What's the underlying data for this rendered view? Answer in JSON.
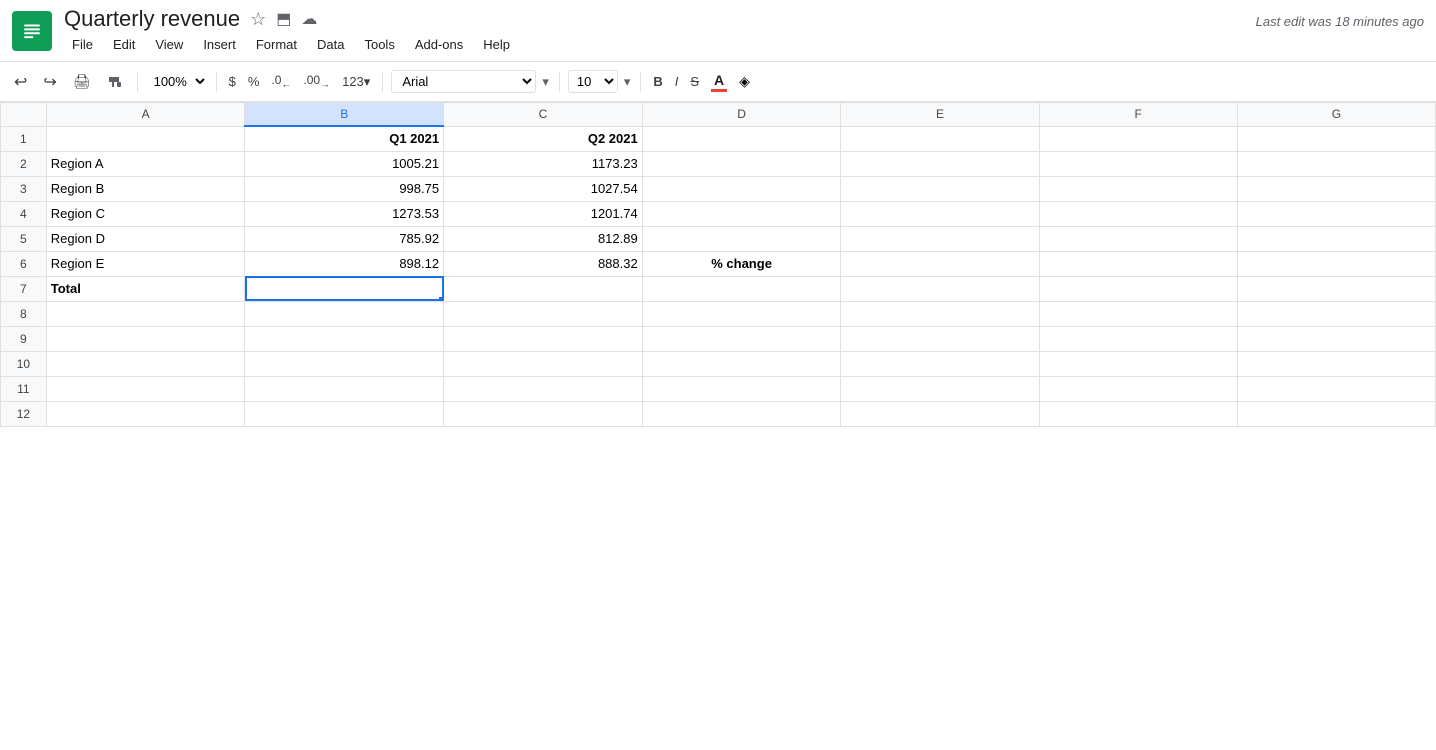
{
  "app": {
    "logo_alt": "Google Sheets logo",
    "title": "Quarterly revenue",
    "last_edit": "Last edit was 18 minutes ago"
  },
  "header_icons": {
    "star": "☆",
    "folder": "⬒",
    "cloud": "☁"
  },
  "menu": {
    "items": [
      "File",
      "Edit",
      "View",
      "Insert",
      "Format",
      "Data",
      "Tools",
      "Add-ons",
      "Help"
    ]
  },
  "toolbar": {
    "undo": "↩",
    "redo": "↪",
    "print": "🖨",
    "paint_format": "🖌",
    "zoom": "100%",
    "currency": "$",
    "percent": "%",
    "decimal_less": ".0",
    "decimal_more": ".00",
    "number_format": "123",
    "font": "Arial",
    "font_size": "10",
    "bold": "B",
    "italic": "I",
    "strikethrough": "S",
    "text_color": "A",
    "fill_color": "◈"
  },
  "columns": {
    "row_num": "",
    "A": "A",
    "B": "B",
    "C": "C",
    "D": "D",
    "E": "E",
    "F": "F",
    "G": "G"
  },
  "sheet": {
    "rows": [
      {
        "num": "1",
        "A": "",
        "B": "Q1 2021",
        "C": "Q2 2021",
        "D": "",
        "E": "",
        "F": "",
        "G": "",
        "B_bold": true,
        "C_bold": true
      },
      {
        "num": "2",
        "A": "Region A",
        "B": "1005.21",
        "C": "1173.23",
        "D": "",
        "E": "",
        "F": "",
        "G": ""
      },
      {
        "num": "3",
        "A": "Region B",
        "B": "998.75",
        "C": "1027.54",
        "D": "",
        "E": "",
        "F": "",
        "G": ""
      },
      {
        "num": "4",
        "A": "Region C",
        "B": "1273.53",
        "C": "1201.74",
        "D": "",
        "E": "",
        "F": "",
        "G": ""
      },
      {
        "num": "5",
        "A": "Region D",
        "B": "785.92",
        "C": "812.89",
        "D": "",
        "E": "",
        "F": "",
        "G": ""
      },
      {
        "num": "6",
        "A": "Region E",
        "B": "898.12",
        "C": "888.32",
        "D": "% change",
        "E": "",
        "F": "",
        "G": "",
        "D_bold": true
      },
      {
        "num": "7",
        "A": "Total",
        "B": "",
        "C": "",
        "D": "",
        "E": "",
        "F": "",
        "G": "",
        "A_bold": true,
        "B_selected": true
      },
      {
        "num": "8",
        "A": "",
        "B": "",
        "C": "",
        "D": "",
        "E": "",
        "F": "",
        "G": ""
      },
      {
        "num": "9",
        "A": "",
        "B": "",
        "C": "",
        "D": "",
        "E": "",
        "F": "",
        "G": ""
      },
      {
        "num": "10",
        "A": "",
        "B": "",
        "C": "",
        "D": "",
        "E": "",
        "F": "",
        "G": ""
      },
      {
        "num": "11",
        "A": "",
        "B": "",
        "C": "",
        "D": "",
        "E": "",
        "F": "",
        "G": ""
      },
      {
        "num": "12",
        "A": "",
        "B": "",
        "C": "",
        "D": "",
        "E": "",
        "F": "",
        "G": ""
      }
    ]
  }
}
